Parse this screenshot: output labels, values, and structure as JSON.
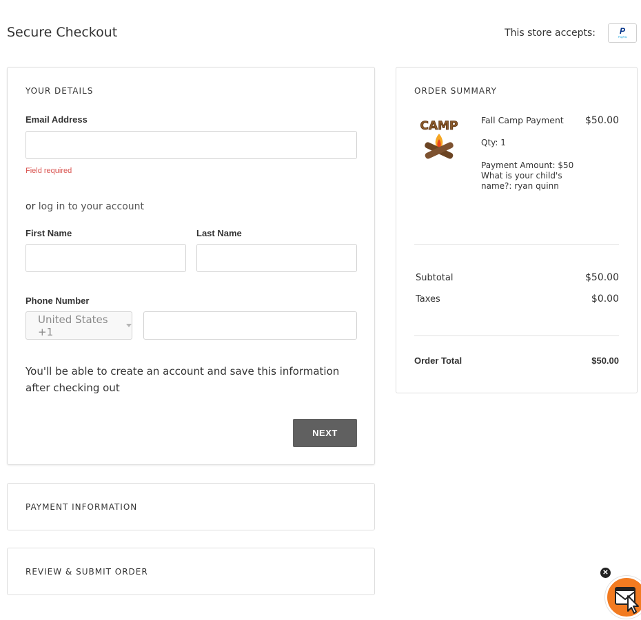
{
  "header": {
    "title": "Secure Checkout",
    "accepts_label": "This store accepts:",
    "payment_badge_icon": "paypal-icon",
    "payment_badge_text": "PayPal"
  },
  "details": {
    "heading": "YOUR DETAILS",
    "email_label": "Email Address",
    "email_value": "",
    "email_error": "Field required",
    "login_prefix": "or ",
    "login_link": "log in to your account",
    "first_name_label": "First Name",
    "first_name_value": "",
    "last_name_label": "Last Name",
    "last_name_value": "",
    "phone_label": "Phone Number",
    "country_value": "United States +1",
    "phone_value": "",
    "info_text": "You'll be able to create an account and save this information after checking out",
    "next_label": "NEXT"
  },
  "payment": {
    "heading": "PAYMENT INFORMATION"
  },
  "review": {
    "heading": "REVIEW & SUBMIT ORDER"
  },
  "summary": {
    "heading": "ORDER SUMMARY",
    "item": {
      "image_text": "CAMP",
      "name": "Fall Camp Payment",
      "price": "$50.00",
      "qty": "Qty: 1",
      "options": "Payment Amount: $50 What is your child's name?: ryan quinn"
    },
    "subtotal_label": "Subtotal",
    "subtotal_value": "$50.00",
    "taxes_label": "Taxes",
    "taxes_value": "$0.00",
    "total_label": "Order Total",
    "total_value": "$50.00"
  },
  "widget": {
    "close_icon": "close-icon",
    "icon": "mail-cursor-icon"
  },
  "colors": {
    "error": "#d9534f",
    "button": "#606060",
    "widget": "#f27b21"
  }
}
